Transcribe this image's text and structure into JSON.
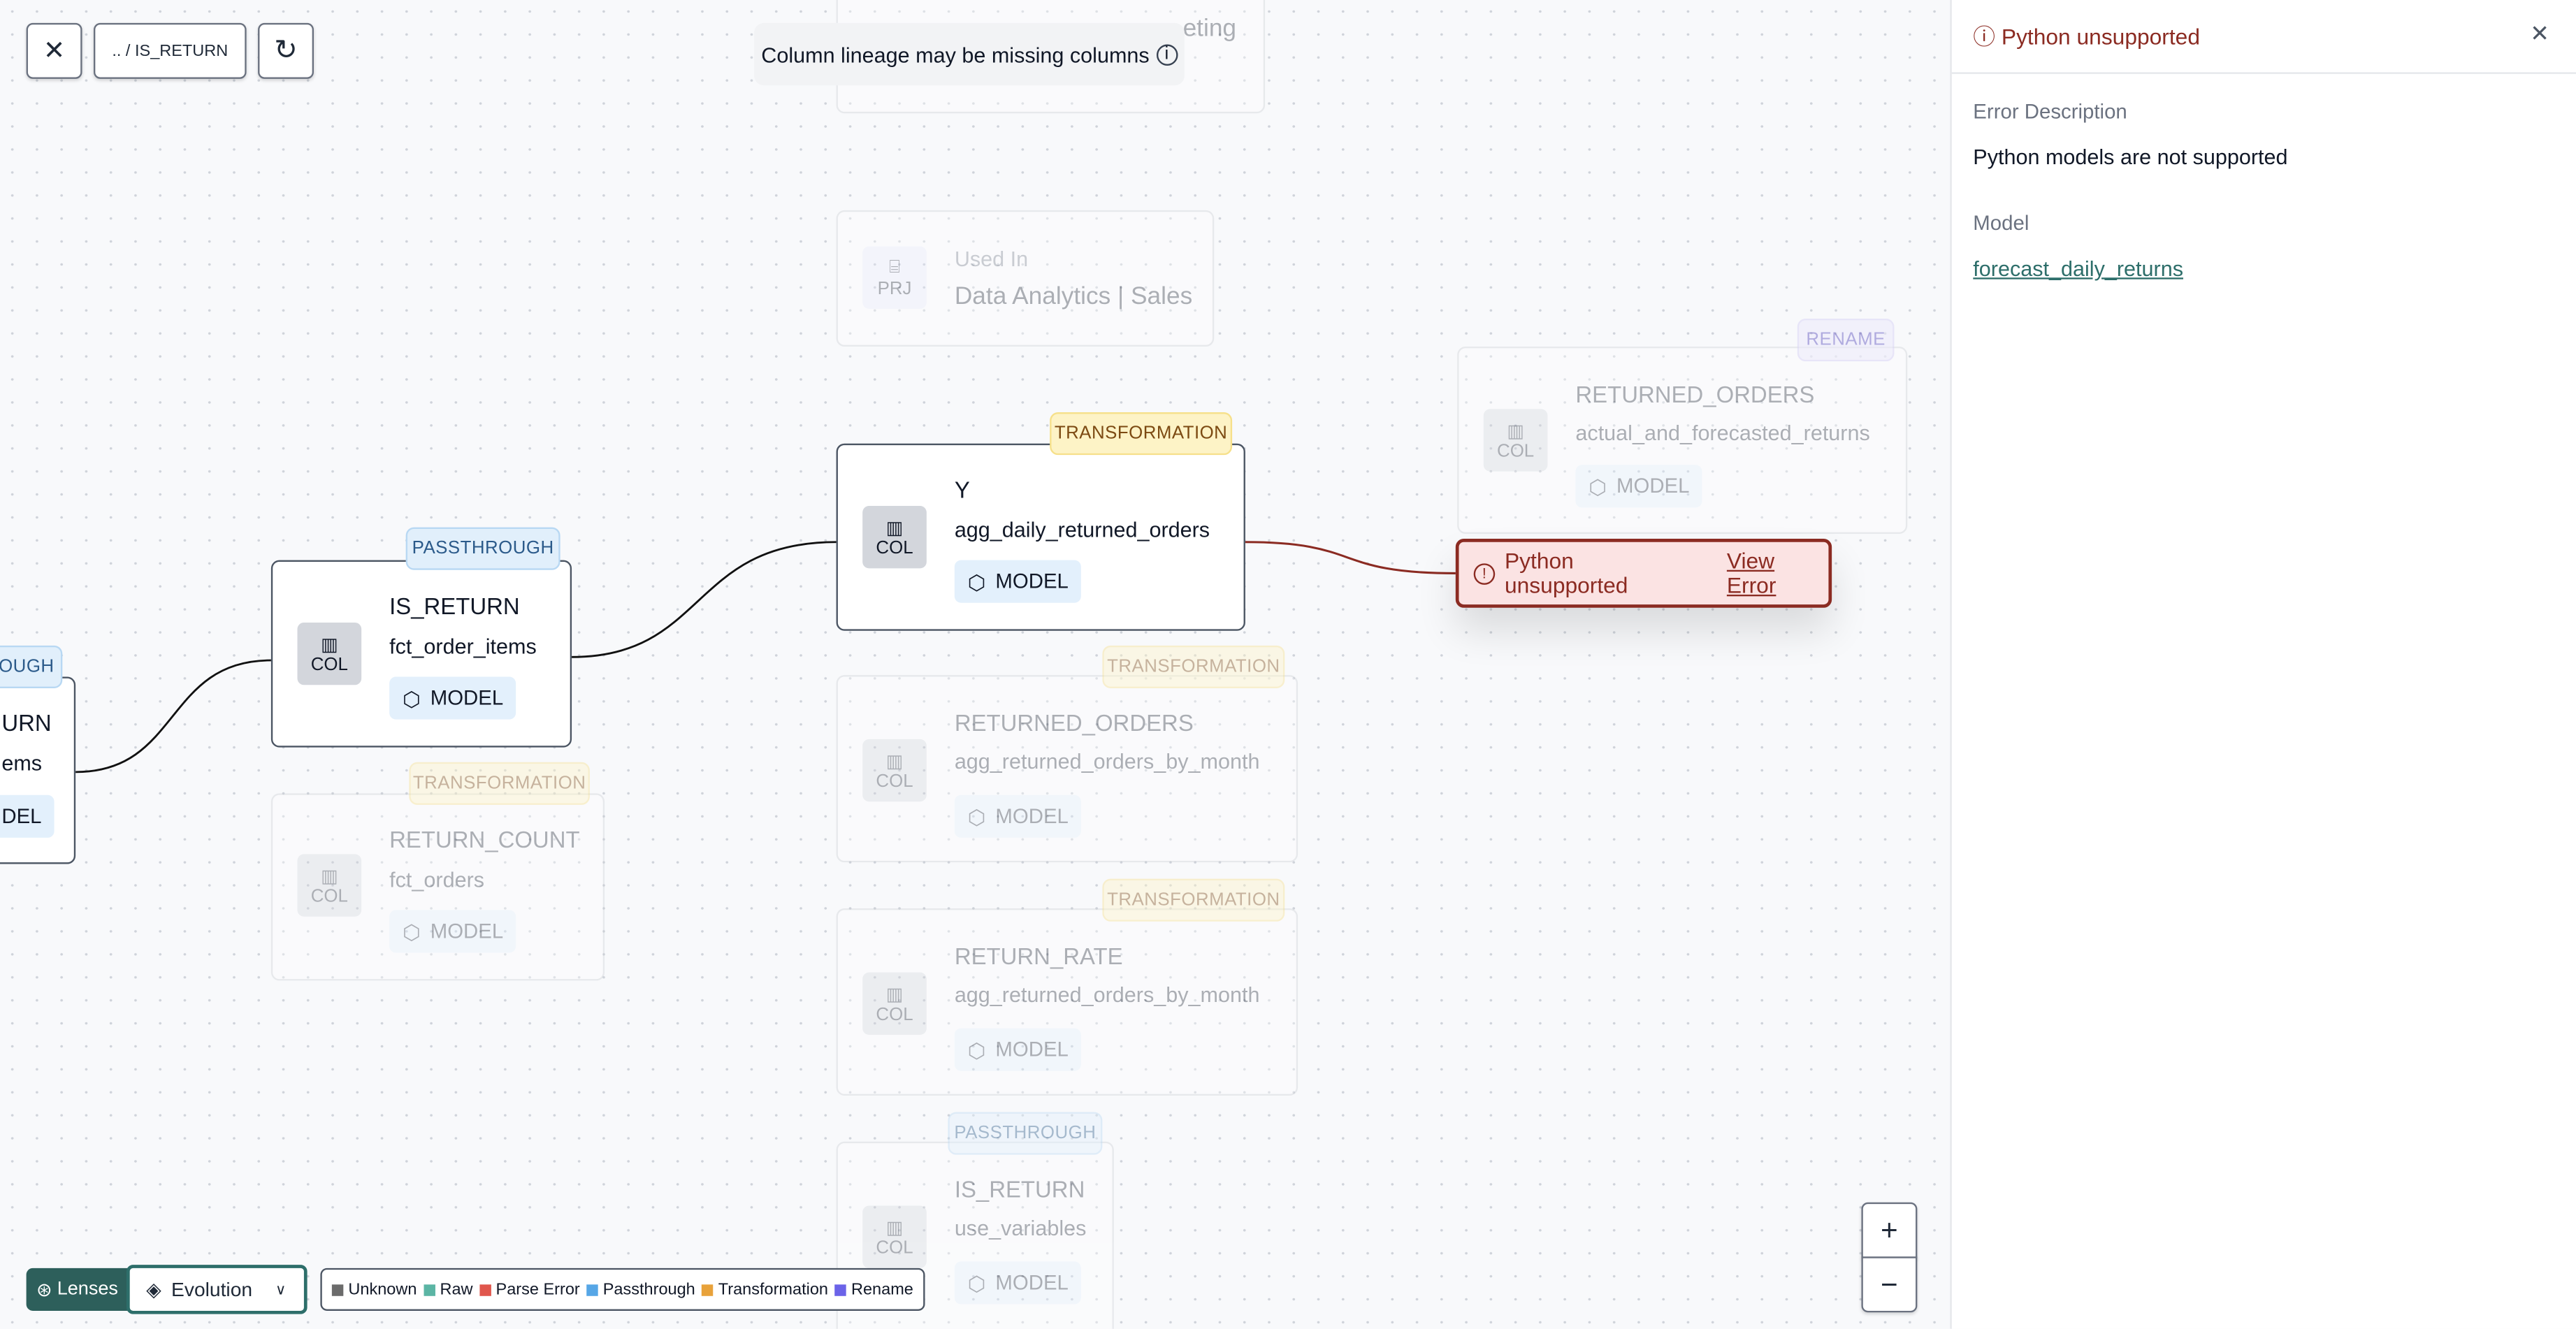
{
  "toolbar": {
    "close_icon": "x-icon",
    "breadcrumb": ".. / IS_RETURN",
    "refresh_icon": "refresh-icon"
  },
  "toast": {
    "text": "Column lineage may be missing columns",
    "icon": "info-icon"
  },
  "nodes": {
    "top_partial": {
      "fragment": "eting"
    },
    "used_in": {
      "icon_label": "PRJ",
      "title": "Used In",
      "value": "Data Analytics | Sales"
    },
    "returned_orders_forecast": {
      "badge": "RENAME",
      "icon_label": "COL",
      "column": "RETURNED_ORDERS",
      "model": "actual_and_forecasted_returns",
      "type": "MODEL"
    },
    "y": {
      "badge": "TRANSFORMATION",
      "icon_label": "COL",
      "column": "Y",
      "model": "agg_daily_returned_orders",
      "type": "MODEL"
    },
    "error": {
      "text": "Python unsupported",
      "link": "View Error"
    },
    "is_return": {
      "badge": "PASSTHROUGH",
      "icon_label": "COL",
      "column": "IS_RETURN",
      "model": "fct_order_items",
      "type": "MODEL"
    },
    "left_partial": {
      "badge": "OUGH",
      "column": "URN",
      "model": "ems",
      "type": "DEL"
    },
    "return_count": {
      "badge": "TRANSFORMATION",
      "icon_label": "COL",
      "column": "RETURN_COUNT",
      "model": "fct_orders",
      "type": "MODEL"
    },
    "returned_orders": {
      "badge": "TRANSFORMATION",
      "icon_label": "COL",
      "column": "RETURNED_ORDERS",
      "model": "agg_returned_orders_by_month",
      "type": "MODEL"
    },
    "return_rate": {
      "badge": "TRANSFORMATION",
      "icon_label": "COL",
      "column": "RETURN_RATE",
      "model": "agg_returned_orders_by_month",
      "type": "MODEL"
    },
    "is_return_vars": {
      "badge": "PASSTHROUGH",
      "icon_label": "COL",
      "column": "IS_RETURN",
      "model": "use_variables",
      "type": "MODEL"
    }
  },
  "zoom": {
    "in": "+",
    "out": "−"
  },
  "bottom": {
    "lenses": "Lenses",
    "lens_select": "Evolution",
    "legend": [
      {
        "label": "Unknown",
        "color": "#6b6b6b"
      },
      {
        "label": "Raw",
        "color": "#5bb5a4"
      },
      {
        "label": "Parse Error",
        "color": "#e0564c"
      },
      {
        "label": "Passthrough",
        "color": "#56a6e6"
      },
      {
        "label": "Transformation",
        "color": "#e8a23a"
      },
      {
        "label": "Rename",
        "color": "#6b63e8"
      }
    ]
  },
  "panel": {
    "title": "Python unsupported",
    "desc_label": "Error Description",
    "desc": "Python models are not supported",
    "model_label": "Model",
    "model_link": "forecast_daily_returns"
  },
  "colors": {
    "accent": "#2d5f5b",
    "error": "#8b2b22",
    "error_bg": "#fbe3e3"
  }
}
